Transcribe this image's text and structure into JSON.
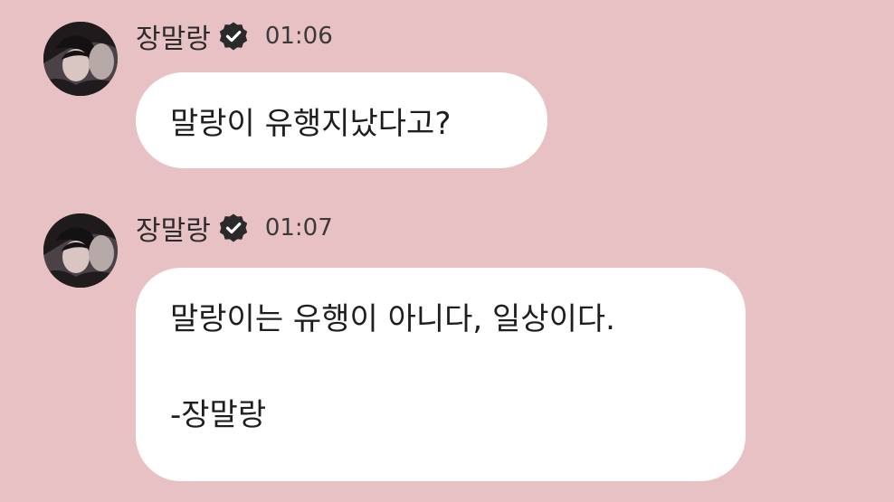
{
  "colors": {
    "background": "#e7c1c4",
    "bubble": "#ffffff",
    "text": "#1e1e1e",
    "verified_badge": "#2a2a2a"
  },
  "messages": [
    {
      "sender": "장말랑",
      "verified_icon": "verified-badge-icon",
      "time": "01:06",
      "text": "말랑이 유행지났다고?"
    },
    {
      "sender": "장말랑",
      "verified_icon": "verified-badge-icon",
      "time": "01:07",
      "lines": [
        "말랑이는 유행이 아니다, 일상이다.",
        "-장말랑"
      ]
    }
  ]
}
